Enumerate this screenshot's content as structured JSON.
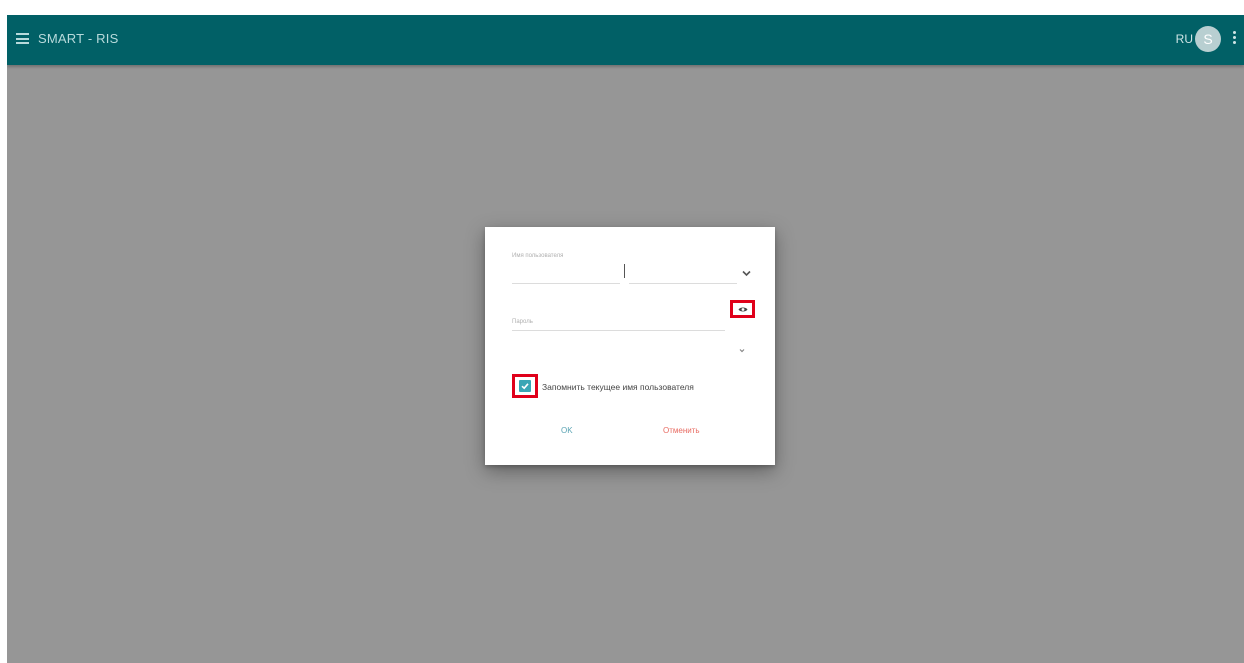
{
  "header": {
    "title": "SMART - RIS",
    "language": "RU",
    "avatar_initial": "S",
    "menu_icon": "menu-icon",
    "more_icon": "more-vertical-icon",
    "background_color": "#016066"
  },
  "login_dialog": {
    "username": {
      "label": "Имя пользователя",
      "value": "",
      "dropdown_icon": "chevron-down-icon"
    },
    "password": {
      "label": "Пароль",
      "value": "",
      "toggle_icon": "eye-icon"
    },
    "extra_dropdown_icon": "chevron-down-icon",
    "remember_checkbox": {
      "checked": true,
      "label": "Запомнить текущее имя пользователя"
    },
    "ok_label": "OK",
    "cancel_label": "Отменить",
    "ok_color": "#5aa3b3",
    "cancel_color": "#e86b62"
  },
  "highlight_color": "#e0001a"
}
